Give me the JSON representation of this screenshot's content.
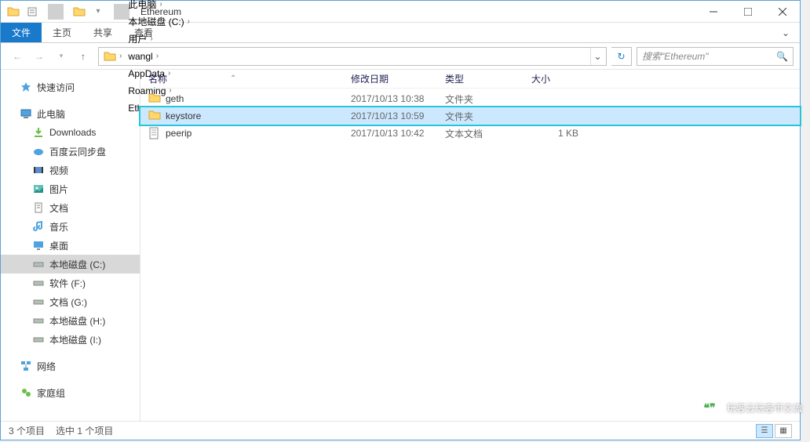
{
  "title": "Ethereum",
  "ribbon": {
    "file": "文件",
    "home": "主页",
    "share": "共享",
    "view": "查看"
  },
  "breadcrumbs": [
    {
      "label": "此电脑"
    },
    {
      "label": "本地磁盘 (C:)"
    },
    {
      "label": "用户"
    },
    {
      "label": "wangl"
    },
    {
      "label": "AppData"
    },
    {
      "label": "Roaming"
    },
    {
      "label": "Ethereum"
    }
  ],
  "search_placeholder": "搜索\"Ethereum\"",
  "columns": {
    "name": "名称",
    "date": "修改日期",
    "type": "类型",
    "size": "大小"
  },
  "sidebar": {
    "quick": "快速访问",
    "thispc": "此电脑",
    "items": [
      {
        "icon": "download",
        "label": "Downloads"
      },
      {
        "icon": "cloud",
        "label": "百度云同步盘"
      },
      {
        "icon": "video",
        "label": "视频"
      },
      {
        "icon": "picture",
        "label": "图片"
      },
      {
        "icon": "doc",
        "label": "文档"
      },
      {
        "icon": "music",
        "label": "音乐"
      },
      {
        "icon": "desktop",
        "label": "桌面"
      },
      {
        "icon": "drive",
        "label": "本地磁盘 (C:)",
        "selected": true
      },
      {
        "icon": "drive",
        "label": "软件 (F:)"
      },
      {
        "icon": "drive",
        "label": "文档 (G:)"
      },
      {
        "icon": "drive",
        "label": "本地磁盘 (H:)"
      },
      {
        "icon": "drive",
        "label": "本地磁盘 (I:)"
      }
    ],
    "network": "网络",
    "homegroup": "家庭组"
  },
  "rows": [
    {
      "icon": "folder",
      "name": "geth",
      "date": "2017/10/13 10:38",
      "type": "文件夹",
      "size": ""
    },
    {
      "icon": "folder",
      "name": "keystore",
      "date": "2017/10/13 10:59",
      "type": "文件夹",
      "size": "",
      "selected": true
    },
    {
      "icon": "txt",
      "name": "peerip",
      "date": "2017/10/13 10:42",
      "type": "文本文档",
      "size": "1 KB"
    }
  ],
  "status": {
    "count": "3 个项目",
    "selected": "选中 1 个项目"
  },
  "watermark": "玩客云玩客币交流"
}
